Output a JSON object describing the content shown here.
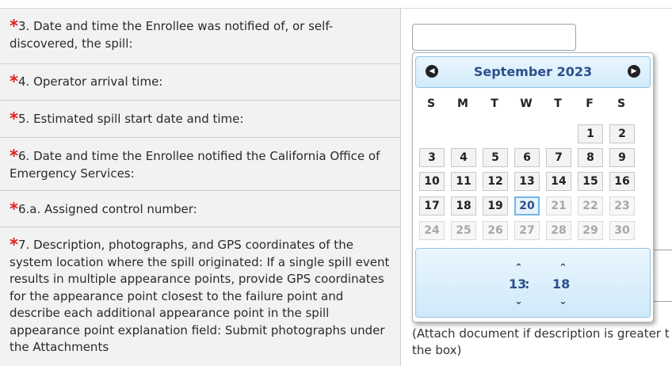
{
  "form": {
    "fields": [
      {
        "marker": "*",
        "label": "3. Date and time the Enrollee was notified of, or self-discovered, the spill:"
      },
      {
        "marker": "*",
        "label": "4. Operator arrival time:"
      },
      {
        "marker": "*",
        "label": "5. Estimated spill start date and time:"
      },
      {
        "marker": "*",
        "label": "6. Date and time the Enrollee notified the California Office of Emergency Services:"
      },
      {
        "marker": "*",
        "label": "6.a. Assigned control number:"
      },
      {
        "marker": "*",
        "label": "7. Description, photographs, and GPS coordinates of the system location where the spill originated: If a single spill event results in multiple appearance points, provide GPS coordinates for the appearance point closest to the failure point and describe each additional appearance point in the spill appearance point explanation field: Submit photographs under the Attachments"
      }
    ],
    "attach_note_line1": "(Attach document if description is greater t",
    "attach_note_line2": "the box)"
  },
  "datepicker": {
    "prev_icon": "chevron-left-icon",
    "next_icon": "chevron-right-icon",
    "prev_glyph": "◀",
    "next_glyph": "▶",
    "month_label": "September 2023",
    "weekdays": [
      "S",
      "M",
      "T",
      "W",
      "T",
      "F",
      "S"
    ],
    "weeks": [
      [
        "",
        "",
        "",
        "",
        "",
        "1",
        "2"
      ],
      [
        "3",
        "4",
        "5",
        "6",
        "7",
        "8",
        "9"
      ],
      [
        "10",
        "11",
        "12",
        "13",
        "14",
        "15",
        "16"
      ],
      [
        "17",
        "18",
        "19",
        "20",
        "21",
        "22",
        "23"
      ],
      [
        "24",
        "25",
        "26",
        "27",
        "28",
        "29",
        "30"
      ]
    ],
    "selected_day": "20",
    "time": {
      "hour": "13",
      "separator": ":",
      "minute": "18",
      "up_glyph": "⌃",
      "down_glyph": "⌄"
    }
  }
}
